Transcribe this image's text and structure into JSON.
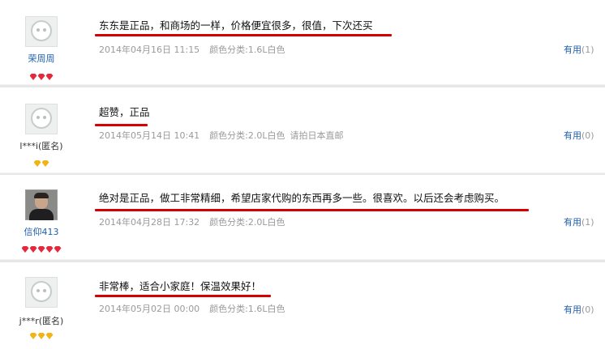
{
  "reviews": [
    {
      "username": "荣周周",
      "comment": "东东是正品，和商场的一样，价格便宜很多，很值，下次还买",
      "date": "2014年04月16日 11:15",
      "spec": "颜色分类:1.6L白色",
      "note": "",
      "useful_label": "有用",
      "useful_count": "(1)"
    },
    {
      "username": "l***i(匿名)",
      "comment": "超赞，正品",
      "date": "2014年05月14日 10:41",
      "spec": "颜色分类:2.0L白色",
      "note": "请拍日本直邮",
      "useful_label": "有用",
      "useful_count": "(0)"
    },
    {
      "username": "信仰413",
      "comment": "绝对是正品，做工非常精细，希望店家代购的东西再多一些。很喜欢。以后还会考虑购买。",
      "date": "2014年04月28日 17:32",
      "spec": "颜色分类:2.0L白色",
      "note": "",
      "useful_label": "有用",
      "useful_count": "(1)"
    },
    {
      "username": "j***r(匿名)",
      "comment": "非常棒，适合小家庭！保温效果好！",
      "date": "2014年05月02日 00:00",
      "spec": "颜色分类:1.6L白色",
      "note": "",
      "useful_label": "有用",
      "useful_count": "(0)"
    }
  ],
  "colors": {
    "link": "#1f5fb1",
    "underline": "#d60000",
    "meta": "#9a9a9a",
    "gem_red": "#e6283c",
    "gem_yellow": "#f0b415"
  }
}
